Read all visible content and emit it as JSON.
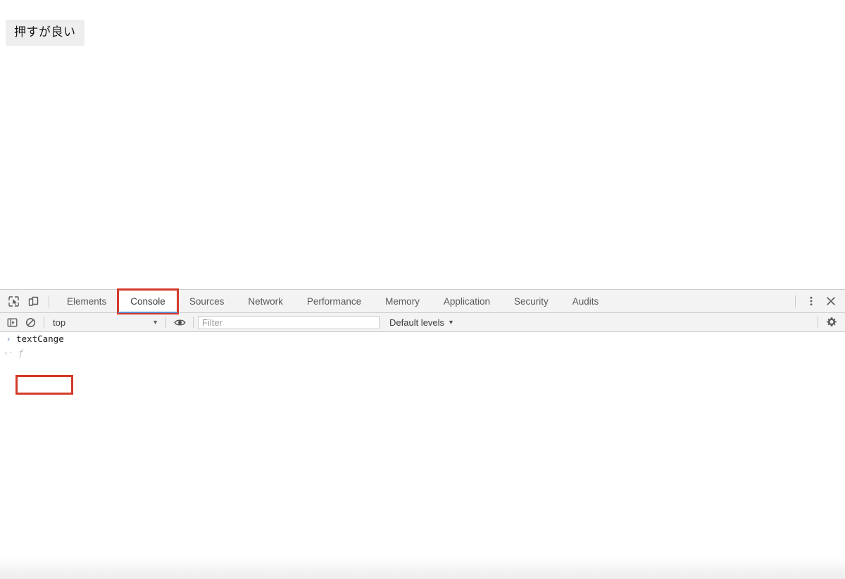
{
  "page": {
    "button_label": "押すが良い"
  },
  "devtools": {
    "toolbar_icons": {
      "inspect": "inspect-element-icon",
      "device": "device-toolbar-icon",
      "more": "more-options-icon",
      "close": "close-icon"
    },
    "tabs": [
      {
        "label": "Elements",
        "active": false,
        "highlighted": false
      },
      {
        "label": "Console",
        "active": true,
        "highlighted": true
      },
      {
        "label": "Sources",
        "active": false,
        "highlighted": false
      },
      {
        "label": "Network",
        "active": false,
        "highlighted": false
      },
      {
        "label": "Performance",
        "active": false,
        "highlighted": false
      },
      {
        "label": "Memory",
        "active": false,
        "highlighted": false
      },
      {
        "label": "Application",
        "active": false,
        "highlighted": false
      },
      {
        "label": "Security",
        "active": false,
        "highlighted": false
      },
      {
        "label": "Audits",
        "active": false,
        "highlighted": false
      }
    ],
    "console_toolbar": {
      "sidebar_toggle_icon": "console-sidebar-icon",
      "clear_icon": "clear-console-icon",
      "context": "top",
      "context_arrow": "▼",
      "eye_icon": "live-expression-icon",
      "filter_placeholder": "Filter",
      "filter_value": "",
      "levels_label": "Default levels",
      "levels_arrow": "▼",
      "settings_icon": "gear-icon"
    },
    "console_output": [
      {
        "prompt": "›",
        "text": "textCange",
        "kind": "input",
        "highlighted": true
      },
      {
        "prompt": "‹·",
        "text": "ƒ",
        "kind": "result",
        "highlighted": false
      }
    ]
  },
  "colors": {
    "annotation_red": "#d43a2a",
    "active_tab_underline": "#5a8fd6",
    "toolbar_bg": "#f3f3f3",
    "border": "#cdcdcd",
    "button_bg": "#eeeeee"
  }
}
